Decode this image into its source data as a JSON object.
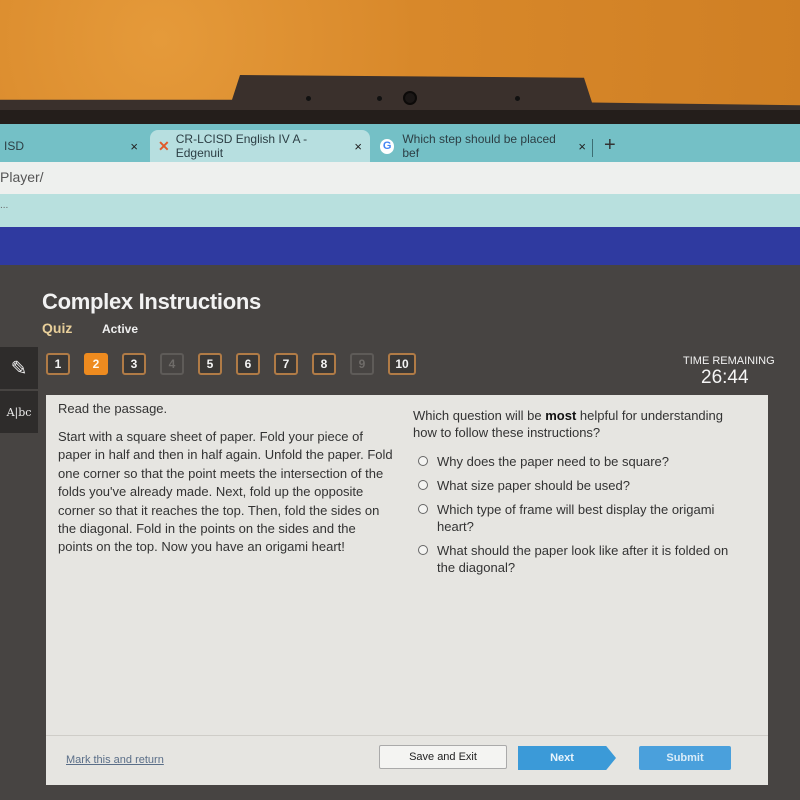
{
  "browser": {
    "tabs": [
      {
        "label": "ISD",
        "close": "×"
      },
      {
        "label": "CR-LCISD English IV A - Edgenuit",
        "close": "×",
        "active": true
      },
      {
        "label": "Which step should be placed bef",
        "close": "×"
      }
    ],
    "new_tab": "+",
    "url": "Player/",
    "bookmarks": "..."
  },
  "lesson": {
    "title": "Complex Instructions",
    "type": "Quiz",
    "status": "Active"
  },
  "tools": {
    "pencil": "✎",
    "dictionary": "A|bc"
  },
  "question_nav": {
    "current": 2,
    "items": [
      {
        "label": "1",
        "state": "answered"
      },
      {
        "label": "2",
        "state": "current"
      },
      {
        "label": "3",
        "state": "answered"
      },
      {
        "label": "4",
        "state": "disabled"
      },
      {
        "label": "5",
        "state": "answered"
      },
      {
        "label": "6",
        "state": "answered"
      },
      {
        "label": "7",
        "state": "answered"
      },
      {
        "label": "8",
        "state": "answered"
      },
      {
        "label": "9",
        "state": "disabled"
      },
      {
        "label": "10",
        "state": "answered"
      }
    ]
  },
  "timer": {
    "label": "TIME REMAINING",
    "value": "26:44"
  },
  "passage": {
    "intro": "Read the passage.",
    "text": "Start with a square sheet of paper. Fold your piece of paper in half and then in half again. Unfold the paper. Fold one corner so that the point meets the intersection of the folds you've already made. Next, fold up the opposite corner so that it reaches the top. Then, fold the sides on the diagonal. Fold in the points on the sides and the points on the top. Now you have an origami heart!"
  },
  "question": {
    "prefix": "Which question will be ",
    "emphasis": "most",
    "suffix": " helpful for understanding how to follow these instructions?",
    "options": [
      "Why does the paper need to be square?",
      "What size paper should be used?",
      "Which type of frame will best display the origami heart?",
      "What should the paper look like after it is folded on the diagonal?"
    ]
  },
  "footer": {
    "mark_link": "Mark this and return",
    "save_exit": "Save and Exit",
    "next": "Next",
    "submit": "Submit"
  },
  "colors": {
    "accent_orange": "#ee8b1f",
    "button_blue": "#3b9ad8",
    "header_blue": "#2f3aa0"
  }
}
